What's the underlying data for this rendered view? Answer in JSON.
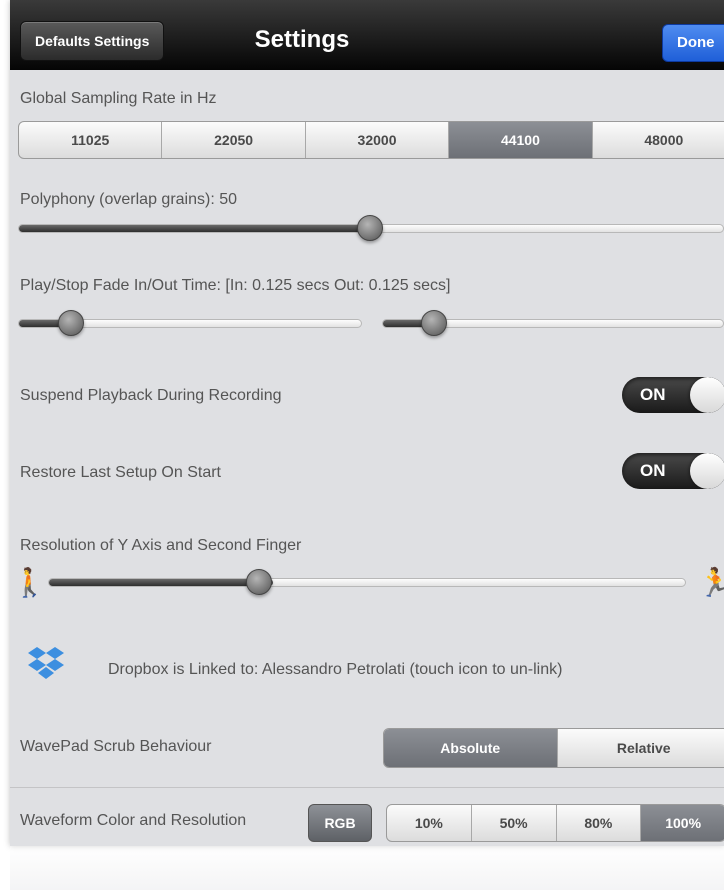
{
  "navbar": {
    "left_button": "Defaults Settings",
    "title": "Settings",
    "right_button": "Done"
  },
  "sampling": {
    "label": "Global Sampling Rate in Hz",
    "options": [
      "11025",
      "22050",
      "32000",
      "44100",
      "48000"
    ],
    "selected": "44100"
  },
  "polyphony": {
    "label": "Polyphony (overlap grains): 50",
    "level": 0.5
  },
  "fade": {
    "label": "Play/Stop Fade In/Out Time: [In: 0.125 secs  Out: 0.125 secs]",
    "in_level": 0.15,
    "out_level": 0.15
  },
  "suspend": {
    "label": "Suspend Playback During Recording",
    "toggle": "ON"
  },
  "restore": {
    "label": "Restore Last Setup On Start",
    "toggle": "ON"
  },
  "resolution": {
    "label": "Resolution of Y Axis and Second Finger",
    "level": 0.35,
    "left_icon": "walking-person-icon",
    "right_icon": "running-person-icon"
  },
  "dropbox": {
    "icon": "dropbox-icon",
    "text": "Dropbox is Linked to: Alessandro Petrolati (touch icon to un-link)",
    "color": "#3d8fe0"
  },
  "scrub": {
    "label": "WavePad Scrub Behaviour",
    "options": [
      "Absolute",
      "Relative"
    ],
    "selected": "Absolute"
  },
  "waveform": {
    "label": "Waveform Color and Resolution",
    "color_button": "RGB",
    "options": [
      "10%",
      "50%",
      "80%",
      "100%"
    ],
    "selected": "100%"
  }
}
